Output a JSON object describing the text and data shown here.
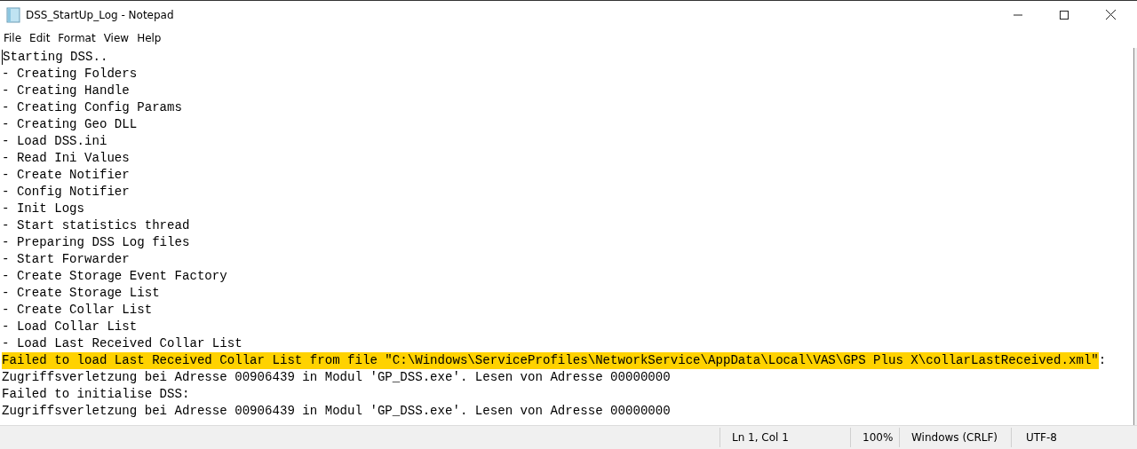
{
  "window": {
    "title": "DSS_StartUp_Log - Notepad"
  },
  "menu": [
    "File",
    "Edit",
    "Format",
    "View",
    "Help"
  ],
  "lines": [
    {
      "text": "Starting DSS..",
      "highlighted": false
    },
    {
      "text": "- Creating Folders",
      "highlighted": false
    },
    {
      "text": "- Creating Handle",
      "highlighted": false
    },
    {
      "text": "- Creating Config Params",
      "highlighted": false
    },
    {
      "text": "- Creating Geo DLL",
      "highlighted": false
    },
    {
      "text": "- Load DSS.ini",
      "highlighted": false
    },
    {
      "text": "- Read Ini Values",
      "highlighted": false
    },
    {
      "text": "- Create Notifier",
      "highlighted": false
    },
    {
      "text": "- Config Notifier",
      "highlighted": false
    },
    {
      "text": "- Init Logs",
      "highlighted": false
    },
    {
      "text": "- Start statistics thread",
      "highlighted": false
    },
    {
      "text": "- Preparing DSS Log files",
      "highlighted": false
    },
    {
      "text": "- Start Forwarder",
      "highlighted": false
    },
    {
      "text": "- Create Storage Event Factory",
      "highlighted": false
    },
    {
      "text": "- Create Storage List",
      "highlighted": false
    },
    {
      "text": "- Create Collar List",
      "highlighted": false
    },
    {
      "text": "- Load Collar List",
      "highlighted": false
    },
    {
      "text": "- Load Last Received Collar List",
      "highlighted": false
    },
    {
      "text": "Failed to load Last Received Collar List from file \"C:\\Windows\\ServiceProfiles\\NetworkService\\AppData\\Local\\VAS\\GPS Plus X\\collarLastReceived.xml\"",
      "after": ":",
      "highlighted": true
    },
    {
      "text": "Zugriffsverletzung bei Adresse 00906439 in Modul 'GP_DSS.exe'. Lesen von Adresse 00000000",
      "highlighted": false
    },
    {
      "text": "Failed to initialise DSS:",
      "highlighted": false
    },
    {
      "text": "Zugriffsverletzung bei Adresse 00906439 in Modul 'GP_DSS.exe'. Lesen von Adresse 00000000",
      "highlighted": false
    }
  ],
  "status_bar": {
    "position": "Ln 1, Col 1",
    "zoom": "100%",
    "line_endings": "Windows (CRLF)",
    "encoding": "UTF-8"
  }
}
